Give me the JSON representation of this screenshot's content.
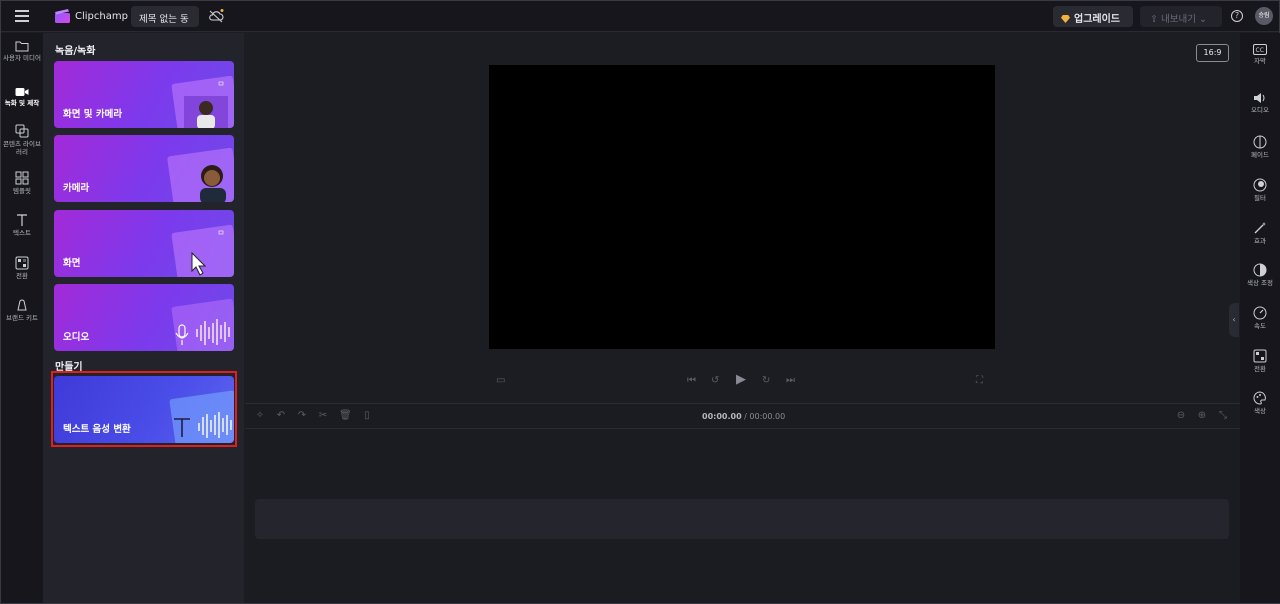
{
  "topbar": {
    "app_name": "Clipchamp",
    "project_title": "제목 없는 동",
    "upgrade_label": "업그레이드",
    "export_label": "내보내기",
    "avatar_initials": "승림",
    "brand_gradient": [
      "#8b5cf6",
      "#d946ef"
    ]
  },
  "leftnav": {
    "items": [
      {
        "label": "사용자 미디어",
        "icon": "folder-icon"
      },
      {
        "label": "녹화 및 제작",
        "icon": "video-camera-icon",
        "active": true
      },
      {
        "label": "콘텐츠 라이브러리",
        "icon": "content-library-icon"
      },
      {
        "label": "템플릿",
        "icon": "templates-icon"
      },
      {
        "label": "텍스트",
        "icon": "text-icon"
      },
      {
        "label": "전환",
        "icon": "transitions-icon"
      },
      {
        "label": "브랜드 키트",
        "icon": "brand-kit-icon"
      }
    ]
  },
  "panel": {
    "record_section_title": "녹음/녹화",
    "cards": [
      {
        "label": "화면 및 카메라"
      },
      {
        "label": "카메라"
      },
      {
        "label": "화면"
      },
      {
        "label": "오디오"
      }
    ],
    "create_section_title": "만들기",
    "tts_card": {
      "label": "텍스트 음성 변환"
    },
    "highlight_color": "#e02020"
  },
  "stage": {
    "aspect_ratio": "16:9"
  },
  "timeline": {
    "current_time": "00:00.00",
    "separator": " / ",
    "total_time": "00:00.00"
  },
  "rightpanel": {
    "items": [
      {
        "label": "자막",
        "icon": "captions-icon"
      },
      {
        "label": "오디오",
        "icon": "audio-icon"
      },
      {
        "label": "페이드",
        "icon": "fade-icon"
      },
      {
        "label": "필터",
        "icon": "filters-icon"
      },
      {
        "label": "효과",
        "icon": "effects-icon"
      },
      {
        "label": "색상 조정",
        "icon": "color-adjust-icon"
      },
      {
        "label": "속도",
        "icon": "speed-icon"
      },
      {
        "label": "전환",
        "icon": "transition-icon"
      },
      {
        "label": "색상",
        "icon": "color-palette-icon"
      }
    ]
  }
}
